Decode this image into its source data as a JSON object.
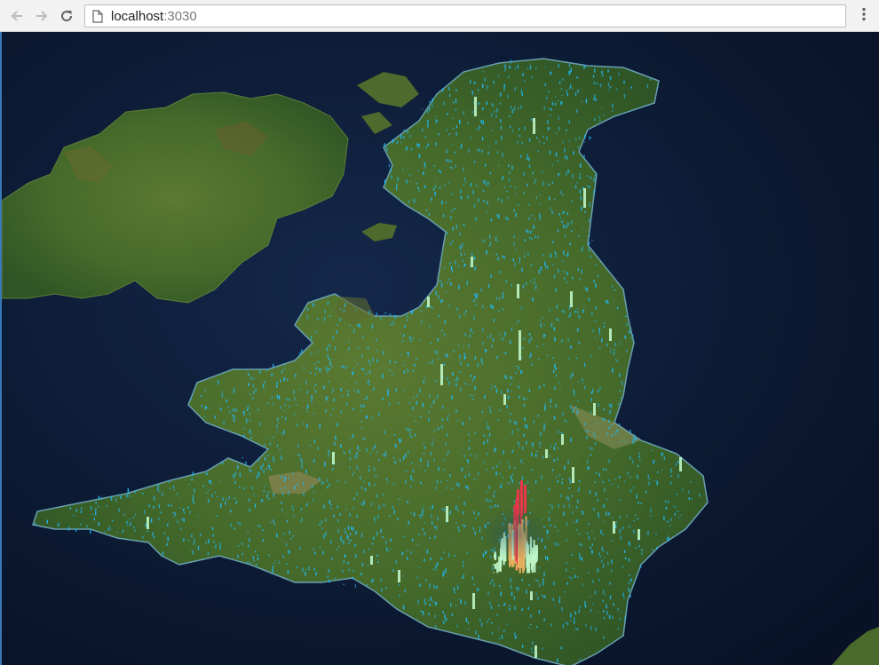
{
  "browser": {
    "address": {
      "host": "localhost",
      "port": ":3030"
    },
    "icons": {
      "back": "back-arrow-icon",
      "forward": "forward-arrow-icon",
      "reload": "reload-icon",
      "page": "page-icon",
      "menu": "kebab-menu-icon"
    }
  },
  "map": {
    "colors": {
      "ocean": "#0c1a33",
      "land": "#4a6a2c",
      "bars_low": "#22b6f0",
      "bars_mid": "#bff6c8",
      "bars_high": "#e8364a"
    }
  }
}
